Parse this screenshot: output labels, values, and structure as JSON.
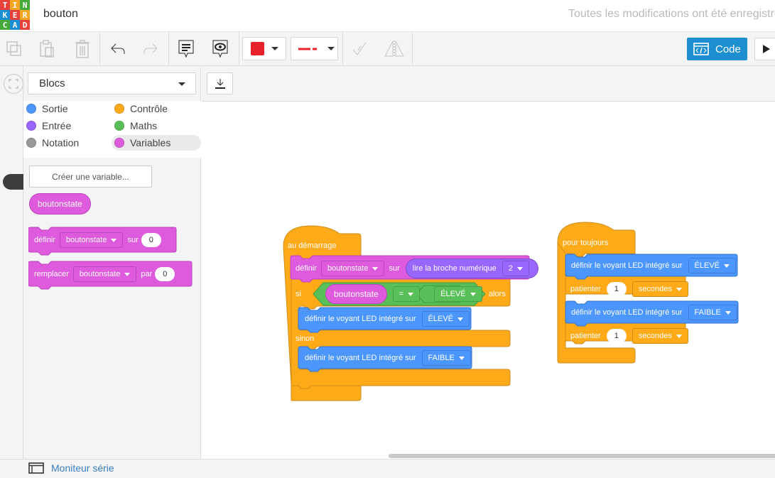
{
  "app": {
    "logo_letters": [
      "T",
      "I",
      "N",
      "K",
      "E",
      "R",
      "C",
      "A",
      "D"
    ],
    "logo_colors": [
      "#e8413a",
      "#f5a623",
      "#45aa3b",
      "#1a8fd3",
      "#e8413a",
      "#f5a623",
      "#45aa3b",
      "#1a8fd3",
      "#e8413a"
    ],
    "title": "bouton",
    "save_status": "Toutes les modifications ont été enregistrées"
  },
  "toolbar": {
    "icons": [
      "copy-icon",
      "paste-icon",
      "delete-icon",
      "undo-icon",
      "redo-icon",
      "notes-icon",
      "visibility-icon",
      "color-picker",
      "line-style-picker",
      "mirror-tool-icon",
      "flip-icon"
    ],
    "color_value": "#e8222a",
    "code_label": "Code"
  },
  "palette": {
    "mode": "Blocs",
    "categories": [
      {
        "label": "Sortie",
        "color": "#4c97ff"
      },
      {
        "label": "Contrôle",
        "color": "#ffab19"
      },
      {
        "label": "Entrée",
        "color": "#9966ff"
      },
      {
        "label": "Maths",
        "color": "#59c059"
      },
      {
        "label": "Notation",
        "color": "#999999"
      },
      {
        "label": "Variables",
        "color": "#de5bde"
      }
    ],
    "create_variable": "Créer une variable...",
    "variable_name": "boutonstate",
    "set_block": {
      "verb": "définir",
      "var": "boutonstate",
      "prep": "sur",
      "value": "0"
    },
    "change_block": {
      "verb": "remplacer",
      "var": "boutonstate",
      "prep": "par",
      "value": "0"
    }
  },
  "script_setup": {
    "hat": "au démarrage",
    "set": {
      "verb": "définir",
      "var": "boutonstate",
      "prep": "sur",
      "reporter": "lire la broche numérique",
      "pin": "2"
    },
    "if": {
      "si": "si",
      "left": "boutonstate",
      "op": "=",
      "right": "ÉLEVÉ",
      "then": "alors"
    },
    "led_high": {
      "text": "définir le voyant LED intégré sur",
      "value": "ÉLEVÉ"
    },
    "else": "sinon",
    "led_low": {
      "text": "définir le voyant LED intégré sur",
      "value": "FAIBLE"
    }
  },
  "script_loop": {
    "hat": "pour toujours",
    "led_high": {
      "text": "définir le voyant LED intégré sur",
      "value": "ÉLEVÉ"
    },
    "wait1": {
      "verb": "patienter",
      "value": "1",
      "unit": "secondes"
    },
    "led_low": {
      "text": "définir le voyant LED intégré sur",
      "value": "FAIBLE"
    },
    "wait2": {
      "verb": "patienter",
      "value": "1",
      "unit": "secondes"
    }
  },
  "statusbar": {
    "serial": "Moniteur série"
  },
  "colors": {
    "control": "#ffab19",
    "control_dark": "#cf8b17",
    "output": "#4c97ff",
    "output_dark": "#3373cc",
    "variables": "#de5bde",
    "variables_dark": "#bd42bd",
    "input": "#9966ff",
    "math": "#59c059"
  }
}
